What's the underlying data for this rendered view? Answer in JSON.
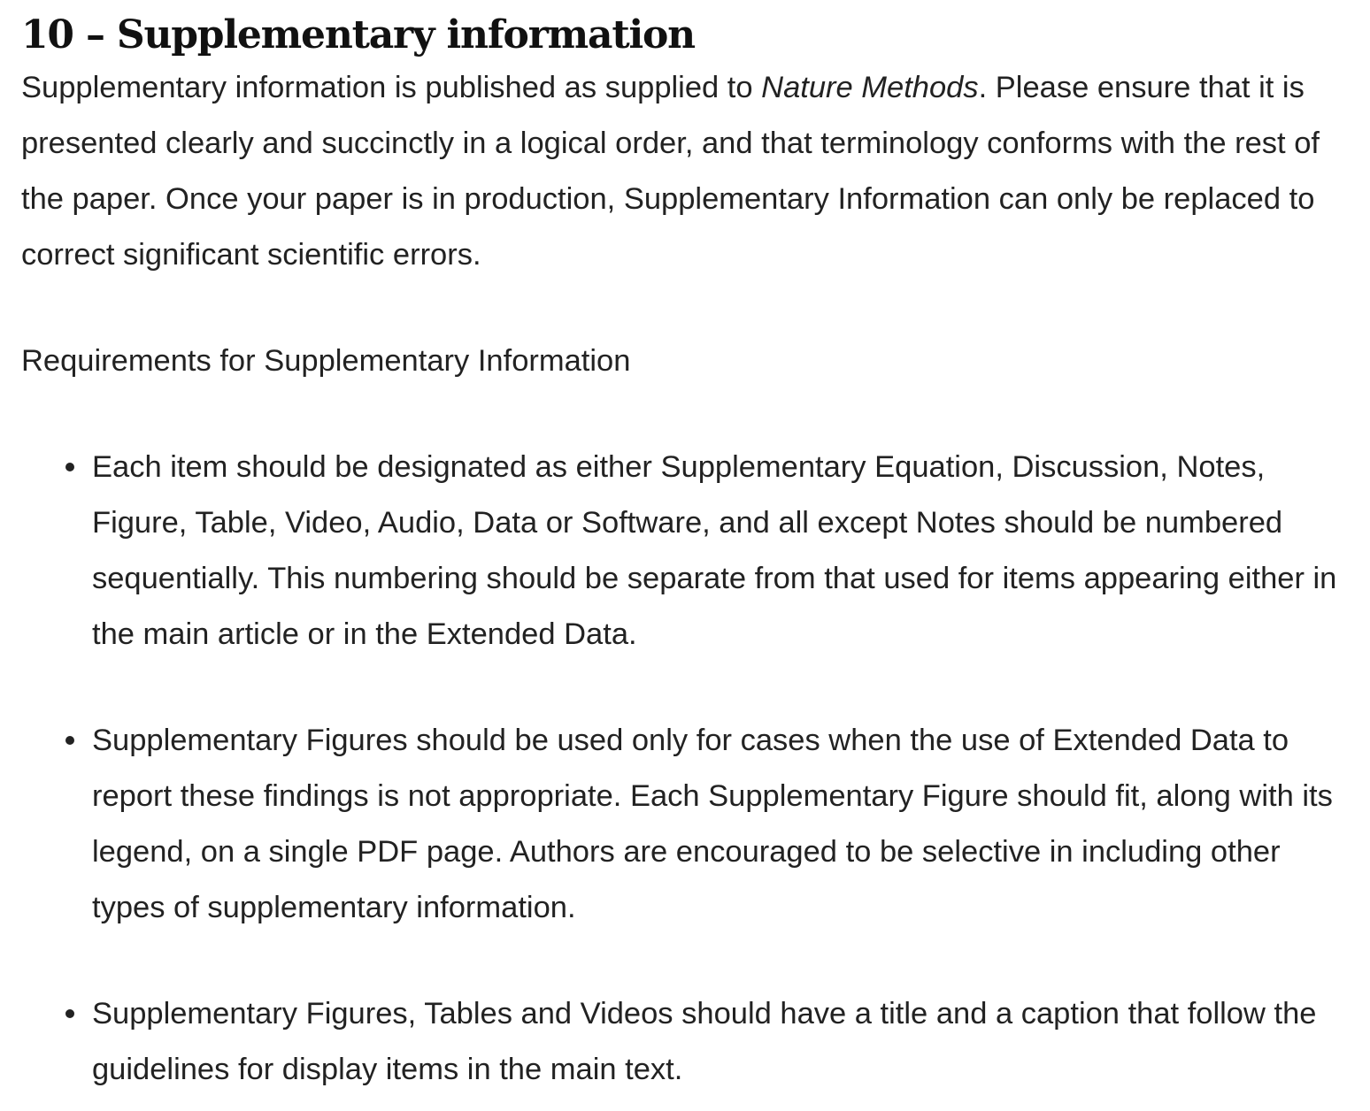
{
  "section": {
    "title": "10 – Supplementary information"
  },
  "intro": {
    "text_before_italic": "Supplementary information is published as supplied to ",
    "italic_journal": "Nature Methods",
    "text_after_italic": ". Please ensure that it is presented clearly and succinctly in a logical order, and that terminology conforms with the rest of the paper. Once your paper is in production, Supplementary Information can only be replaced to correct significant scientific errors."
  },
  "requirements": {
    "heading": "Requirements for Supplementary Information",
    "items": [
      "Each item should be designated as either Supplementary Equation, Discussion, Notes, Figure, Table, Video, Audio, Data or Software, and all except Notes should be numbered sequentially. This numbering should be separate from that used for items appearing either in the main article or in the Extended Data.",
      "Supplementary Figures should be used only for cases when the use of Extended Data to report these findings is not appropriate. Each Supplementary Figure should fit, along with its legend, on a single PDF page. Authors are encouraged to be selective in including other types of supplementary information.",
      "Supplementary Figures, Tables and Videos should have a title and a caption that follow the guidelines for display items in the main text."
    ]
  }
}
